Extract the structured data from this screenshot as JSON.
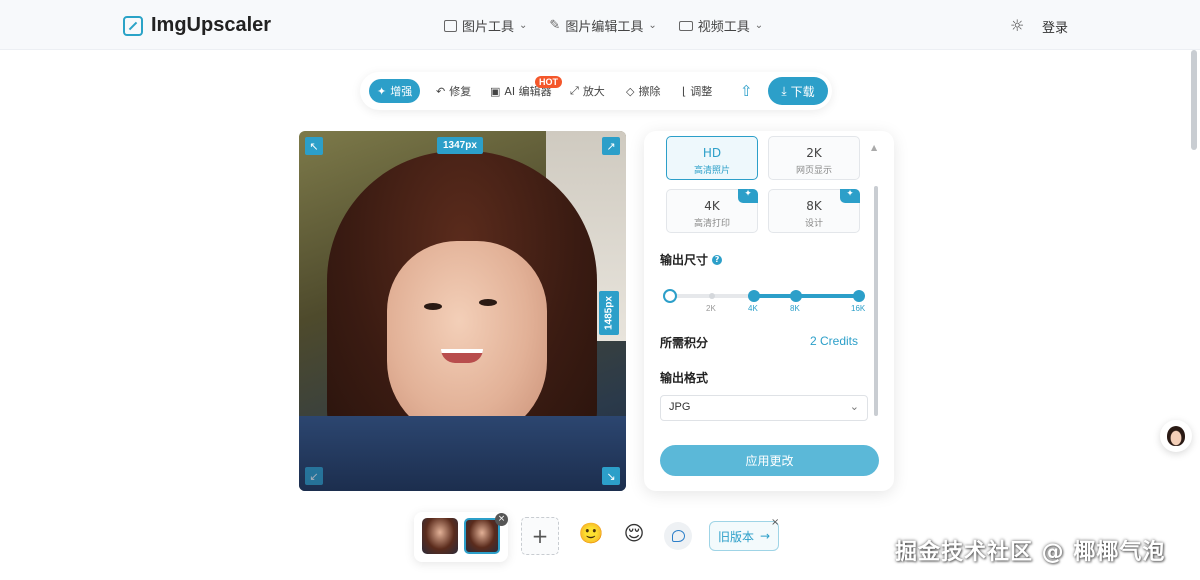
{
  "app": {
    "name": "ImgUpscaler"
  },
  "nav": {
    "items": [
      {
        "label": "图片工具"
      },
      {
        "label": "图片编辑工具"
      },
      {
        "label": "视频工具"
      }
    ],
    "login_label": "登录"
  },
  "toolbar": {
    "tools": [
      {
        "label": "增强",
        "icon": "sparkle-icon"
      },
      {
        "label": "修复",
        "icon": "undo-icon"
      },
      {
        "label": "AI 编辑器",
        "icon": "image-edit-icon"
      },
      {
        "label": "放大",
        "icon": "expand-icon"
      },
      {
        "label": "擦除",
        "icon": "eraser-icon"
      },
      {
        "label": "调整",
        "icon": "sliders-icon"
      }
    ],
    "hot_badge": "HOT",
    "download_label": "下载"
  },
  "image": {
    "width_label": "1347px",
    "height_label": "1485px"
  },
  "panel": {
    "presets": [
      {
        "title": "HD",
        "sub": "高清照片",
        "selected": true
      },
      {
        "title": "2K",
        "sub": "网页显示",
        "selected": false
      },
      {
        "title": "4K",
        "sub": "高清打印",
        "selected": false,
        "pro": true
      },
      {
        "title": "8K",
        "sub": "设计",
        "selected": false,
        "pro": true
      }
    ],
    "output_size_label": "输出尺寸",
    "help_glyph": "?",
    "slider_ticks": [
      "2K",
      "4K",
      "8K",
      "16K"
    ],
    "credits_label": "所需积分",
    "credits_value": "2 Credits",
    "format_label": "输出格式",
    "format_value": "JPG",
    "apply_label": "应用更改"
  },
  "bottom": {
    "add_label": "+",
    "old_version_label": "旧版本",
    "close_glyph": "×"
  },
  "watermark": "掘金技术社区 @ 椰椰气泡",
  "colors": {
    "accent": "#2c9fc9",
    "hot": "#f4572b",
    "apply": "#5bb8d8"
  }
}
